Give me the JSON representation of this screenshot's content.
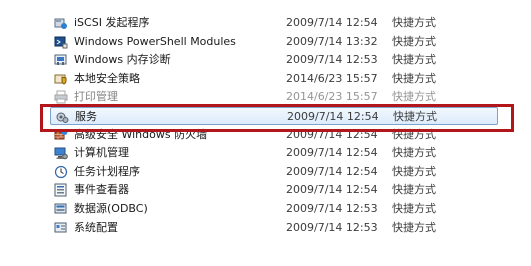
{
  "files": [
    {
      "name": "iSCSI 发起程序",
      "date": "2009/7/14 12:54",
      "type": "快捷方式",
      "icon": "iscsi-icon",
      "state": "normal"
    },
    {
      "name": "Windows PowerShell Modules",
      "date": "2009/7/14 13:32",
      "type": "快捷方式",
      "icon": "powershell-icon",
      "state": "normal"
    },
    {
      "name": "Windows 内存诊断",
      "date": "2009/7/14 12:53",
      "type": "快捷方式",
      "icon": "memory-diagnostic-icon",
      "state": "normal"
    },
    {
      "name": "本地安全策略",
      "date": "2014/6/23 15:57",
      "type": "快捷方式",
      "icon": "security-policy-icon",
      "state": "normal"
    },
    {
      "name": "打印管理",
      "date": "2014/6/23 15:57",
      "type": "快捷方式",
      "icon": "print-management-icon",
      "state": "faded"
    },
    {
      "name": "服务",
      "date": "2009/7/14 12:54",
      "type": "快捷方式",
      "icon": "services-icon",
      "state": "selected"
    },
    {
      "name": "高级安全 Windows 防火墙",
      "date": "2009/7/14 12:54",
      "type": "快捷方式",
      "icon": "firewall-icon",
      "state": "normal"
    },
    {
      "name": "计算机管理",
      "date": "2009/7/14 12:54",
      "type": "快捷方式",
      "icon": "computer-management-icon",
      "state": "normal"
    },
    {
      "name": "任务计划程序",
      "date": "2009/7/14 12:54",
      "type": "快捷方式",
      "icon": "task-scheduler-icon",
      "state": "normal"
    },
    {
      "name": "事件查看器",
      "date": "2009/7/14 12:54",
      "type": "快捷方式",
      "icon": "event-viewer-icon",
      "state": "normal"
    },
    {
      "name": "数据源(ODBC)",
      "date": "2009/7/14 12:53",
      "type": "快捷方式",
      "icon": "odbc-icon",
      "state": "normal"
    },
    {
      "name": "系统配置",
      "date": "2009/7/14 12:53",
      "type": "快捷方式",
      "icon": "system-config-icon",
      "state": "normal"
    }
  ],
  "colors": {
    "highlight_frame": "#b3161a",
    "selection_border": "#7da2ce",
    "selection_fill": "#dcebfc"
  }
}
